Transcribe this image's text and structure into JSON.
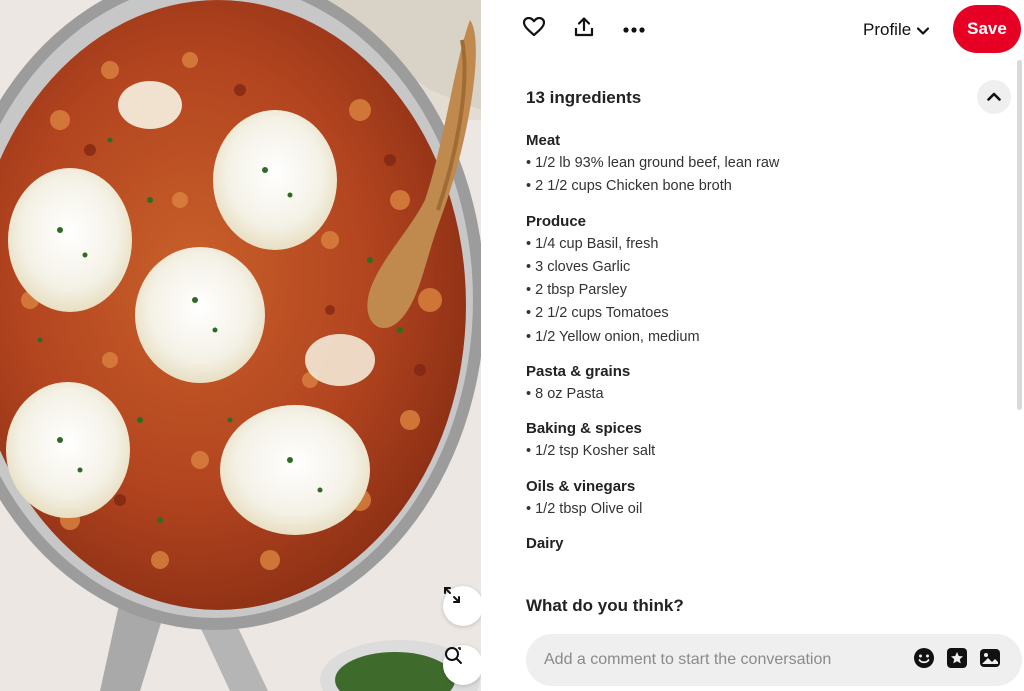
{
  "image": {
    "description_icon": "food-photo",
    "expand_icon": "expand-icon",
    "visual_search_icon": "visual-search-icon"
  },
  "topbar": {
    "like_icon": "heart-icon",
    "share_icon": "share-icon",
    "more_icon": "more-icon",
    "profile_label": "Profile",
    "save_label": "Save",
    "save_color": "#e60023"
  },
  "ingredients": {
    "header": "13 ingredients",
    "groups": [
      {
        "title": "Meat",
        "items": [
          "• 1/2 lb 93% lean ground beef, lean raw",
          "• 2 1/2 cups Chicken bone broth"
        ]
      },
      {
        "title": "Produce",
        "items": [
          "• 1/4 cup Basil, fresh",
          "• 3 cloves Garlic",
          "• 2 tbsp Parsley",
          "• 2 1/2 cups Tomatoes",
          "• 1/2 Yellow onion, medium"
        ]
      },
      {
        "title": "Pasta & grains",
        "items": [
          "• 8 oz Pasta"
        ]
      },
      {
        "title": "Baking & spices",
        "items": [
          "• 1/2 tsp Kosher salt"
        ]
      },
      {
        "title": "Oils & vinegars",
        "items": [
          "• 1/2 tbsp Olive oil"
        ]
      },
      {
        "title": "Dairy",
        "items": []
      }
    ]
  },
  "comments": {
    "heading": "What do you think?",
    "placeholder": "Add a comment to start the conversation"
  }
}
